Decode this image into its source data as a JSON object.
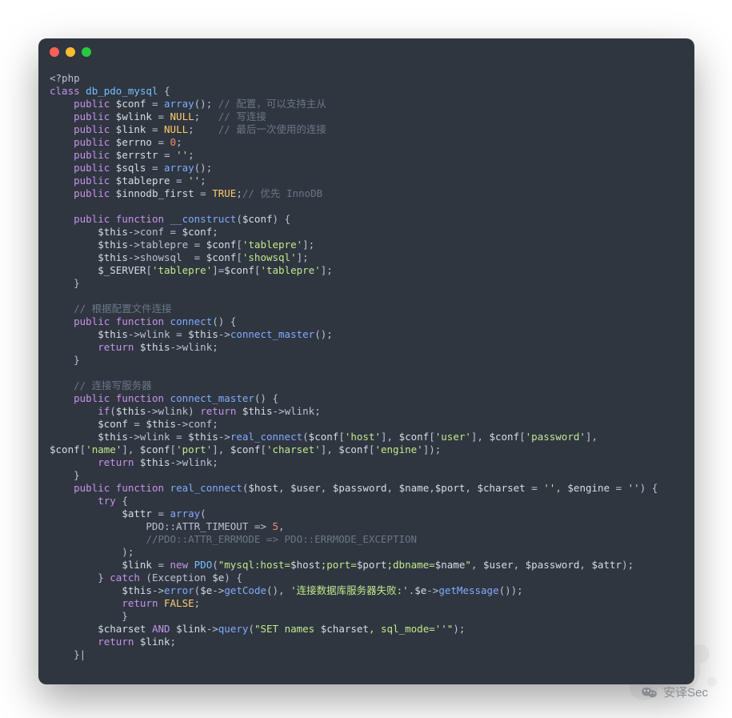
{
  "watermark": {
    "label": "安译Sec"
  },
  "code": {
    "lines": [
      [
        [
          "p",
          "<?php"
        ]
      ],
      [
        [
          "k",
          "class"
        ],
        [
          "p",
          " "
        ],
        [
          "t",
          "db_pdo_mysql"
        ],
        [
          "p",
          " {"
        ]
      ],
      [
        [
          "p",
          "    "
        ],
        [
          "k",
          "public"
        ],
        [
          "p",
          " "
        ],
        [
          "v",
          "$conf"
        ],
        [
          "p",
          " = "
        ],
        [
          "f",
          "array"
        ],
        [
          "p",
          "(); "
        ],
        [
          "c",
          "// 配置，可以支持主从"
        ]
      ],
      [
        [
          "p",
          "    "
        ],
        [
          "k",
          "public"
        ],
        [
          "p",
          " "
        ],
        [
          "v",
          "$wlink"
        ],
        [
          "p",
          " = "
        ],
        [
          "cn",
          "NULL"
        ],
        [
          "p",
          ";   "
        ],
        [
          "c",
          "// 写连接"
        ]
      ],
      [
        [
          "p",
          "    "
        ],
        [
          "k",
          "public"
        ],
        [
          "p",
          " "
        ],
        [
          "v",
          "$link"
        ],
        [
          "p",
          " = "
        ],
        [
          "cn",
          "NULL"
        ],
        [
          "p",
          ";    "
        ],
        [
          "c",
          "// 最后一次使用的连接"
        ]
      ],
      [
        [
          "p",
          "    "
        ],
        [
          "k",
          "public"
        ],
        [
          "p",
          " "
        ],
        [
          "v",
          "$errno"
        ],
        [
          "p",
          " = "
        ],
        [
          "n",
          "0"
        ],
        [
          "p",
          ";"
        ]
      ],
      [
        [
          "p",
          "    "
        ],
        [
          "k",
          "public"
        ],
        [
          "p",
          " "
        ],
        [
          "v",
          "$errstr"
        ],
        [
          "p",
          " = "
        ],
        [
          "s",
          "''"
        ],
        [
          "p",
          ";"
        ]
      ],
      [
        [
          "p",
          "    "
        ],
        [
          "k",
          "public"
        ],
        [
          "p",
          " "
        ],
        [
          "v",
          "$sqls"
        ],
        [
          "p",
          " = "
        ],
        [
          "f",
          "array"
        ],
        [
          "p",
          "();"
        ]
      ],
      [
        [
          "p",
          "    "
        ],
        [
          "k",
          "public"
        ],
        [
          "p",
          " "
        ],
        [
          "v",
          "$tablepre"
        ],
        [
          "p",
          " = "
        ],
        [
          "s",
          "''"
        ],
        [
          "p",
          ";"
        ]
      ],
      [
        [
          "p",
          "    "
        ],
        [
          "k",
          "public"
        ],
        [
          "p",
          " "
        ],
        [
          "v",
          "$innodb_first"
        ],
        [
          "p",
          " = "
        ],
        [
          "cn",
          "TRUE"
        ],
        [
          "p",
          ";"
        ],
        [
          "c",
          "// 优先 InnoDB"
        ]
      ],
      [
        [
          "p",
          ""
        ]
      ],
      [
        [
          "p",
          "    "
        ],
        [
          "k",
          "public"
        ],
        [
          "p",
          " "
        ],
        [
          "k",
          "function"
        ],
        [
          "p",
          " "
        ],
        [
          "f",
          "__construct"
        ],
        [
          "p",
          "("
        ],
        [
          "v",
          "$conf"
        ],
        [
          "p",
          ") {"
        ]
      ],
      [
        [
          "p",
          "        "
        ],
        [
          "v",
          "$this"
        ],
        [
          "p",
          "->conf = "
        ],
        [
          "v",
          "$conf"
        ],
        [
          "p",
          ";"
        ]
      ],
      [
        [
          "p",
          "        "
        ],
        [
          "v",
          "$this"
        ],
        [
          "p",
          "->tablepre = "
        ],
        [
          "v",
          "$conf"
        ],
        [
          "p",
          "["
        ],
        [
          "s",
          "'tablepre'"
        ],
        [
          "p",
          "];"
        ]
      ],
      [
        [
          "p",
          "        "
        ],
        [
          "v",
          "$this"
        ],
        [
          "p",
          "->showsql  = "
        ],
        [
          "v",
          "$conf"
        ],
        [
          "p",
          "["
        ],
        [
          "s",
          "'showsql'"
        ],
        [
          "p",
          "];"
        ]
      ],
      [
        [
          "p",
          "        "
        ],
        [
          "v",
          "$_SERVER"
        ],
        [
          "p",
          "["
        ],
        [
          "s",
          "'tablepre'"
        ],
        [
          "p",
          "]="
        ],
        [
          "v",
          "$conf"
        ],
        [
          "p",
          "["
        ],
        [
          "s",
          "'tablepre'"
        ],
        [
          "p",
          "];"
        ]
      ],
      [
        [
          "p",
          "    }"
        ]
      ],
      [
        [
          "p",
          ""
        ]
      ],
      [
        [
          "p",
          "    "
        ],
        [
          "c",
          "// 根据配置文件连接"
        ]
      ],
      [
        [
          "p",
          "    "
        ],
        [
          "k",
          "public"
        ],
        [
          "p",
          " "
        ],
        [
          "k",
          "function"
        ],
        [
          "p",
          " "
        ],
        [
          "f",
          "connect"
        ],
        [
          "p",
          "() {"
        ]
      ],
      [
        [
          "p",
          "        "
        ],
        [
          "v",
          "$this"
        ],
        [
          "p",
          "->wlink = "
        ],
        [
          "v",
          "$this"
        ],
        [
          "p",
          "->"
        ],
        [
          "f",
          "connect_master"
        ],
        [
          "p",
          "();"
        ]
      ],
      [
        [
          "p",
          "        "
        ],
        [
          "k",
          "return"
        ],
        [
          "p",
          " "
        ],
        [
          "v",
          "$this"
        ],
        [
          "p",
          "->wlink;"
        ]
      ],
      [
        [
          "p",
          "    }"
        ]
      ],
      [
        [
          "p",
          ""
        ]
      ],
      [
        [
          "p",
          "    "
        ],
        [
          "c",
          "// 连接写服务器"
        ]
      ],
      [
        [
          "p",
          "    "
        ],
        [
          "k",
          "public"
        ],
        [
          "p",
          " "
        ],
        [
          "k",
          "function"
        ],
        [
          "p",
          " "
        ],
        [
          "f",
          "connect_master"
        ],
        [
          "p",
          "() {"
        ]
      ],
      [
        [
          "p",
          "        "
        ],
        [
          "k",
          "if"
        ],
        [
          "p",
          "("
        ],
        [
          "v",
          "$this"
        ],
        [
          "p",
          "->wlink) "
        ],
        [
          "k",
          "return"
        ],
        [
          "p",
          " "
        ],
        [
          "v",
          "$this"
        ],
        [
          "p",
          "->wlink;"
        ]
      ],
      [
        [
          "p",
          "        "
        ],
        [
          "v",
          "$conf"
        ],
        [
          "p",
          " = "
        ],
        [
          "v",
          "$this"
        ],
        [
          "p",
          "->conf;"
        ]
      ],
      [
        [
          "p",
          "        "
        ],
        [
          "v",
          "$this"
        ],
        [
          "p",
          "->wlink = "
        ],
        [
          "v",
          "$this"
        ],
        [
          "p",
          "->"
        ],
        [
          "f",
          "real_connect"
        ],
        [
          "p",
          "("
        ],
        [
          "v",
          "$conf"
        ],
        [
          "p",
          "["
        ],
        [
          "s",
          "'host'"
        ],
        [
          "p",
          "], "
        ],
        [
          "v",
          "$conf"
        ],
        [
          "p",
          "["
        ],
        [
          "s",
          "'user'"
        ],
        [
          "p",
          "], "
        ],
        [
          "v",
          "$conf"
        ],
        [
          "p",
          "["
        ],
        [
          "s",
          "'password'"
        ],
        [
          "p",
          "], "
        ]
      ],
      [
        [
          "v",
          "$conf"
        ],
        [
          "p",
          "["
        ],
        [
          "s",
          "'name'"
        ],
        [
          "p",
          "], "
        ],
        [
          "v",
          "$conf"
        ],
        [
          "p",
          "["
        ],
        [
          "s",
          "'port'"
        ],
        [
          "p",
          "], "
        ],
        [
          "v",
          "$conf"
        ],
        [
          "p",
          "["
        ],
        [
          "s",
          "'charset'"
        ],
        [
          "p",
          "], "
        ],
        [
          "v",
          "$conf"
        ],
        [
          "p",
          "["
        ],
        [
          "s",
          "'engine'"
        ],
        [
          "p",
          "]);"
        ]
      ],
      [
        [
          "p",
          "        "
        ],
        [
          "k",
          "return"
        ],
        [
          "p",
          " "
        ],
        [
          "v",
          "$this"
        ],
        [
          "p",
          "->wlink;"
        ]
      ],
      [
        [
          "p",
          "    }"
        ]
      ],
      [
        [
          "p",
          "    "
        ],
        [
          "k",
          "public"
        ],
        [
          "p",
          " "
        ],
        [
          "k",
          "function"
        ],
        [
          "p",
          " "
        ],
        [
          "f",
          "real_connect"
        ],
        [
          "p",
          "("
        ],
        [
          "v",
          "$host"
        ],
        [
          "p",
          ", "
        ],
        [
          "v",
          "$user"
        ],
        [
          "p",
          ", "
        ],
        [
          "v",
          "$password"
        ],
        [
          "p",
          ", "
        ],
        [
          "v",
          "$name"
        ],
        [
          "p",
          ","
        ],
        [
          "v",
          "$port"
        ],
        [
          "p",
          ", "
        ],
        [
          "v",
          "$charset"
        ],
        [
          "p",
          " = "
        ],
        [
          "s",
          "''"
        ],
        [
          "p",
          ", "
        ],
        [
          "v",
          "$engine"
        ],
        [
          "p",
          " = "
        ],
        [
          "s",
          "''"
        ],
        [
          "p",
          ") {"
        ]
      ],
      [
        [
          "p",
          "        "
        ],
        [
          "k",
          "try"
        ],
        [
          "p",
          " {"
        ]
      ],
      [
        [
          "p",
          "            "
        ],
        [
          "v",
          "$attr"
        ],
        [
          "p",
          " = "
        ],
        [
          "f",
          "array"
        ],
        [
          "p",
          "("
        ]
      ],
      [
        [
          "p",
          "                PDO::ATTR_TIMEOUT => "
        ],
        [
          "n",
          "5"
        ],
        [
          "p",
          ","
        ]
      ],
      [
        [
          "p",
          "                "
        ],
        [
          "c",
          "//PDO::ATTR_ERRMODE => PDO::ERRMODE_EXCEPTION"
        ]
      ],
      [
        [
          "p",
          "            );"
        ]
      ],
      [
        [
          "p",
          "            "
        ],
        [
          "v",
          "$link"
        ],
        [
          "p",
          " = "
        ],
        [
          "k",
          "new"
        ],
        [
          "p",
          " "
        ],
        [
          "t",
          "PDO"
        ],
        [
          "p",
          "("
        ],
        [
          "s",
          "\"mysql:host="
        ],
        [
          "v",
          "$host"
        ],
        [
          "s",
          ";port="
        ],
        [
          "v",
          "$port"
        ],
        [
          "s",
          ";dbname="
        ],
        [
          "v",
          "$name"
        ],
        [
          "s",
          "\""
        ],
        [
          "p",
          ", "
        ],
        [
          "v",
          "$user"
        ],
        [
          "p",
          ", "
        ],
        [
          "v",
          "$password"
        ],
        [
          "p",
          ", "
        ],
        [
          "v",
          "$attr"
        ],
        [
          "p",
          ");"
        ]
      ],
      [
        [
          "p",
          "        } "
        ],
        [
          "k",
          "catch"
        ],
        [
          "p",
          " (Exception "
        ],
        [
          "v",
          "$e"
        ],
        [
          "p",
          ") {"
        ]
      ],
      [
        [
          "p",
          "            "
        ],
        [
          "v",
          "$this"
        ],
        [
          "p",
          "->"
        ],
        [
          "f",
          "error"
        ],
        [
          "p",
          "("
        ],
        [
          "v",
          "$e"
        ],
        [
          "p",
          "->"
        ],
        [
          "f",
          "getCode"
        ],
        [
          "p",
          "(), "
        ],
        [
          "s",
          "'连接数据库服务器失败:'"
        ],
        [
          "p",
          "."
        ],
        [
          "v",
          "$e"
        ],
        [
          "p",
          "->"
        ],
        [
          "f",
          "getMessage"
        ],
        [
          "p",
          "());"
        ]
      ],
      [
        [
          "p",
          "            "
        ],
        [
          "k",
          "return"
        ],
        [
          "p",
          " "
        ],
        [
          "cn",
          "FALSE"
        ],
        [
          "p",
          ";"
        ]
      ],
      [
        [
          "p",
          "            }"
        ]
      ],
      [
        [
          "p",
          "        "
        ],
        [
          "v",
          "$charset"
        ],
        [
          "p",
          " "
        ],
        [
          "k",
          "AND"
        ],
        [
          "p",
          " "
        ],
        [
          "v",
          "$link"
        ],
        [
          "p",
          "->"
        ],
        [
          "f",
          "query"
        ],
        [
          "p",
          "("
        ],
        [
          "s",
          "\"SET names "
        ],
        [
          "v",
          "$charset"
        ],
        [
          "s",
          ", sql_mode=''\""
        ],
        [
          "p",
          ");"
        ]
      ],
      [
        [
          "p",
          "        "
        ],
        [
          "k",
          "return"
        ],
        [
          "p",
          " "
        ],
        [
          "v",
          "$link"
        ],
        [
          "p",
          ";"
        ]
      ],
      [
        [
          "p",
          "    }|"
        ]
      ]
    ]
  }
}
